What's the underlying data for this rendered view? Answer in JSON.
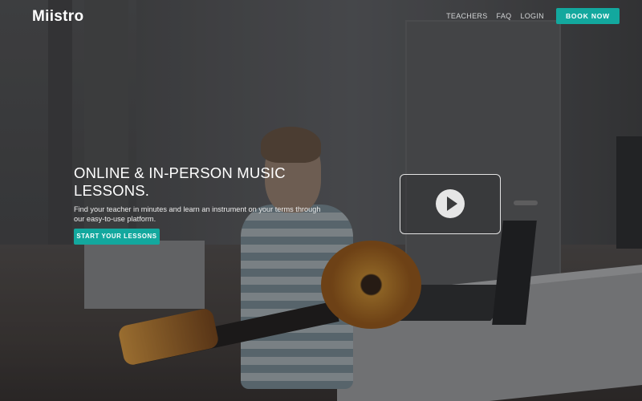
{
  "brand": {
    "logo_text": "Miistro"
  },
  "nav": {
    "items": [
      {
        "label": "TEACHERS"
      },
      {
        "label": "FAQ"
      },
      {
        "label": "LOGIN"
      }
    ],
    "cta_label": "BOOK NOW"
  },
  "hero": {
    "title": "ONLINE & IN-PERSON MUSIC LESSONS.",
    "subtitle": "Find your teacher in minutes and learn an instrument on your terms through our easy-to-use platform.",
    "cta_label": "START YOUR LESSONS"
  },
  "video": {
    "icon": "play-icon"
  },
  "colors": {
    "accent": "#13a89e",
    "text": "#ffffff"
  }
}
